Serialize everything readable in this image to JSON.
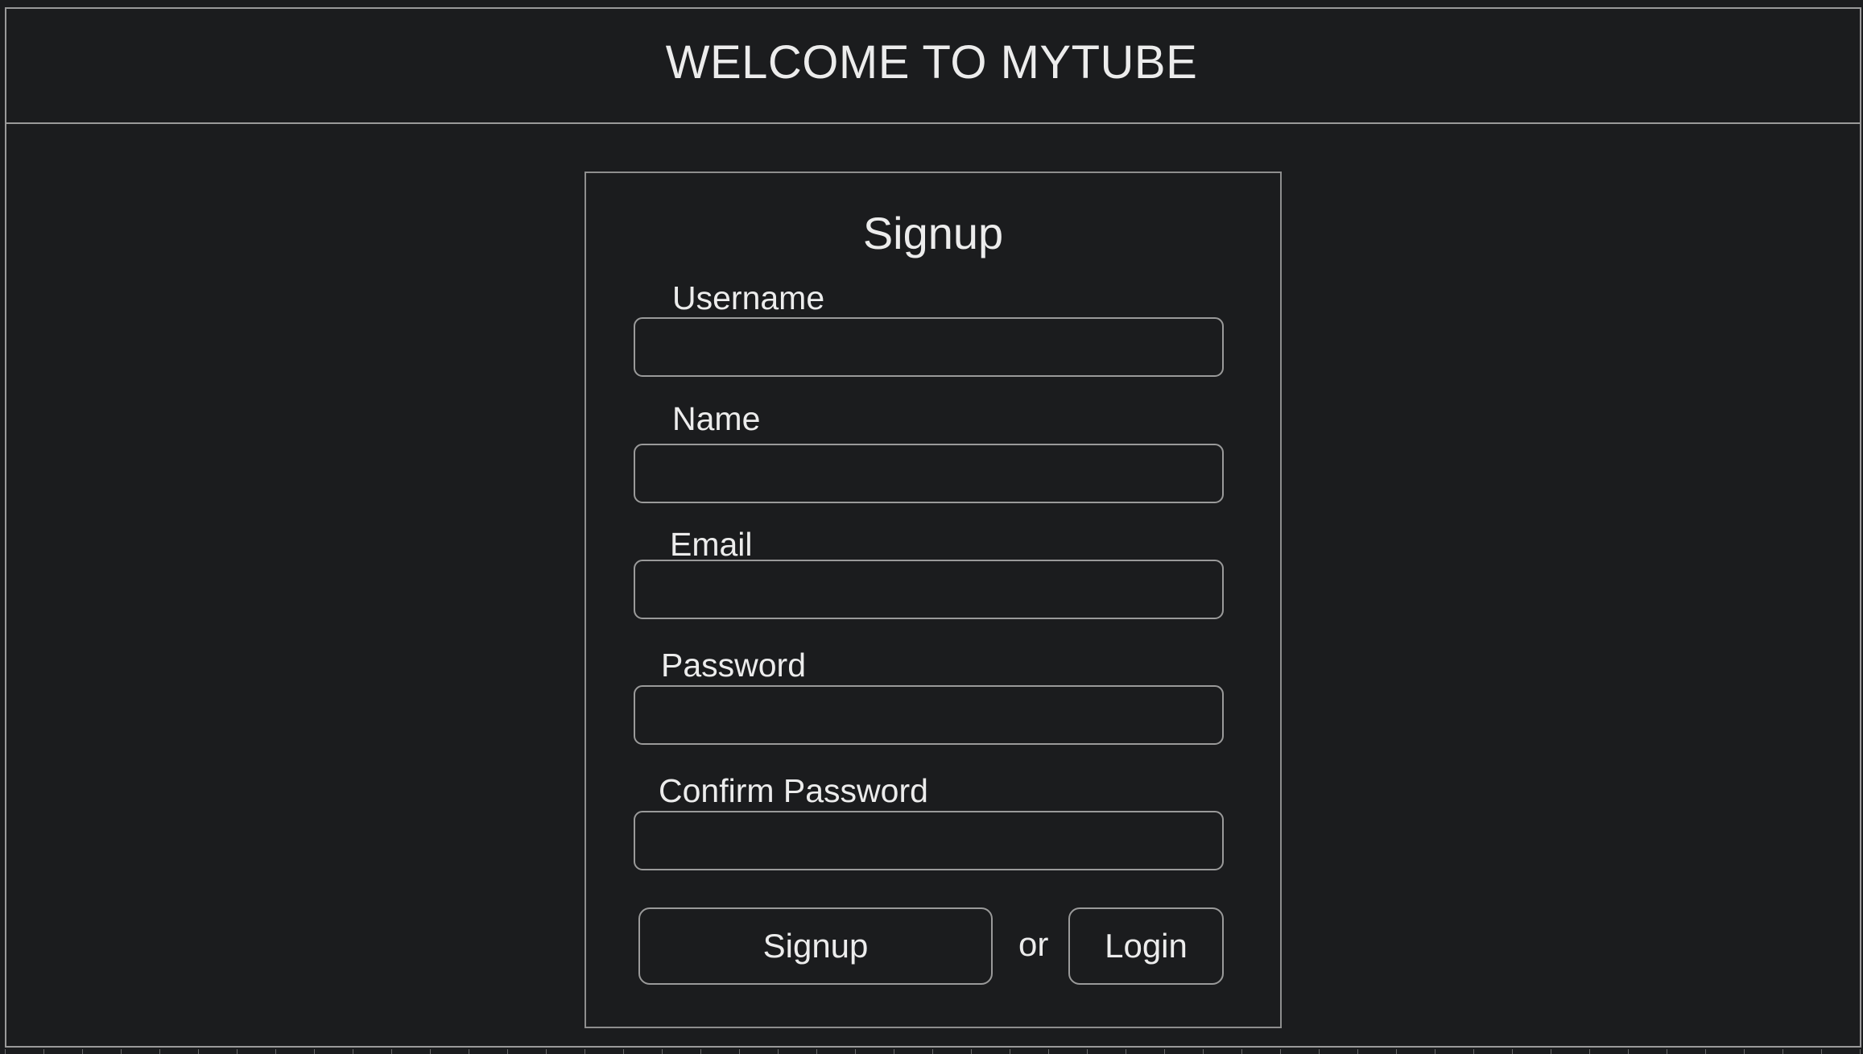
{
  "header": {
    "title": "WELCOME TO MYTUBE"
  },
  "form": {
    "title": "Signup",
    "fields": [
      {
        "label": "Username",
        "value": "",
        "placeholder": ""
      },
      {
        "label": "Name",
        "value": "",
        "placeholder": ""
      },
      {
        "label": "Email",
        "value": "",
        "placeholder": ""
      },
      {
        "label": "Password",
        "value": "",
        "placeholder": ""
      },
      {
        "label": "Confirm Password",
        "value": "",
        "placeholder": ""
      }
    ],
    "signup_button": "Signup",
    "or_text": "or",
    "login_button": "Login"
  },
  "colors": {
    "background": "#1b1c1e",
    "border": "#9a9a9a",
    "text": "#ececec"
  }
}
